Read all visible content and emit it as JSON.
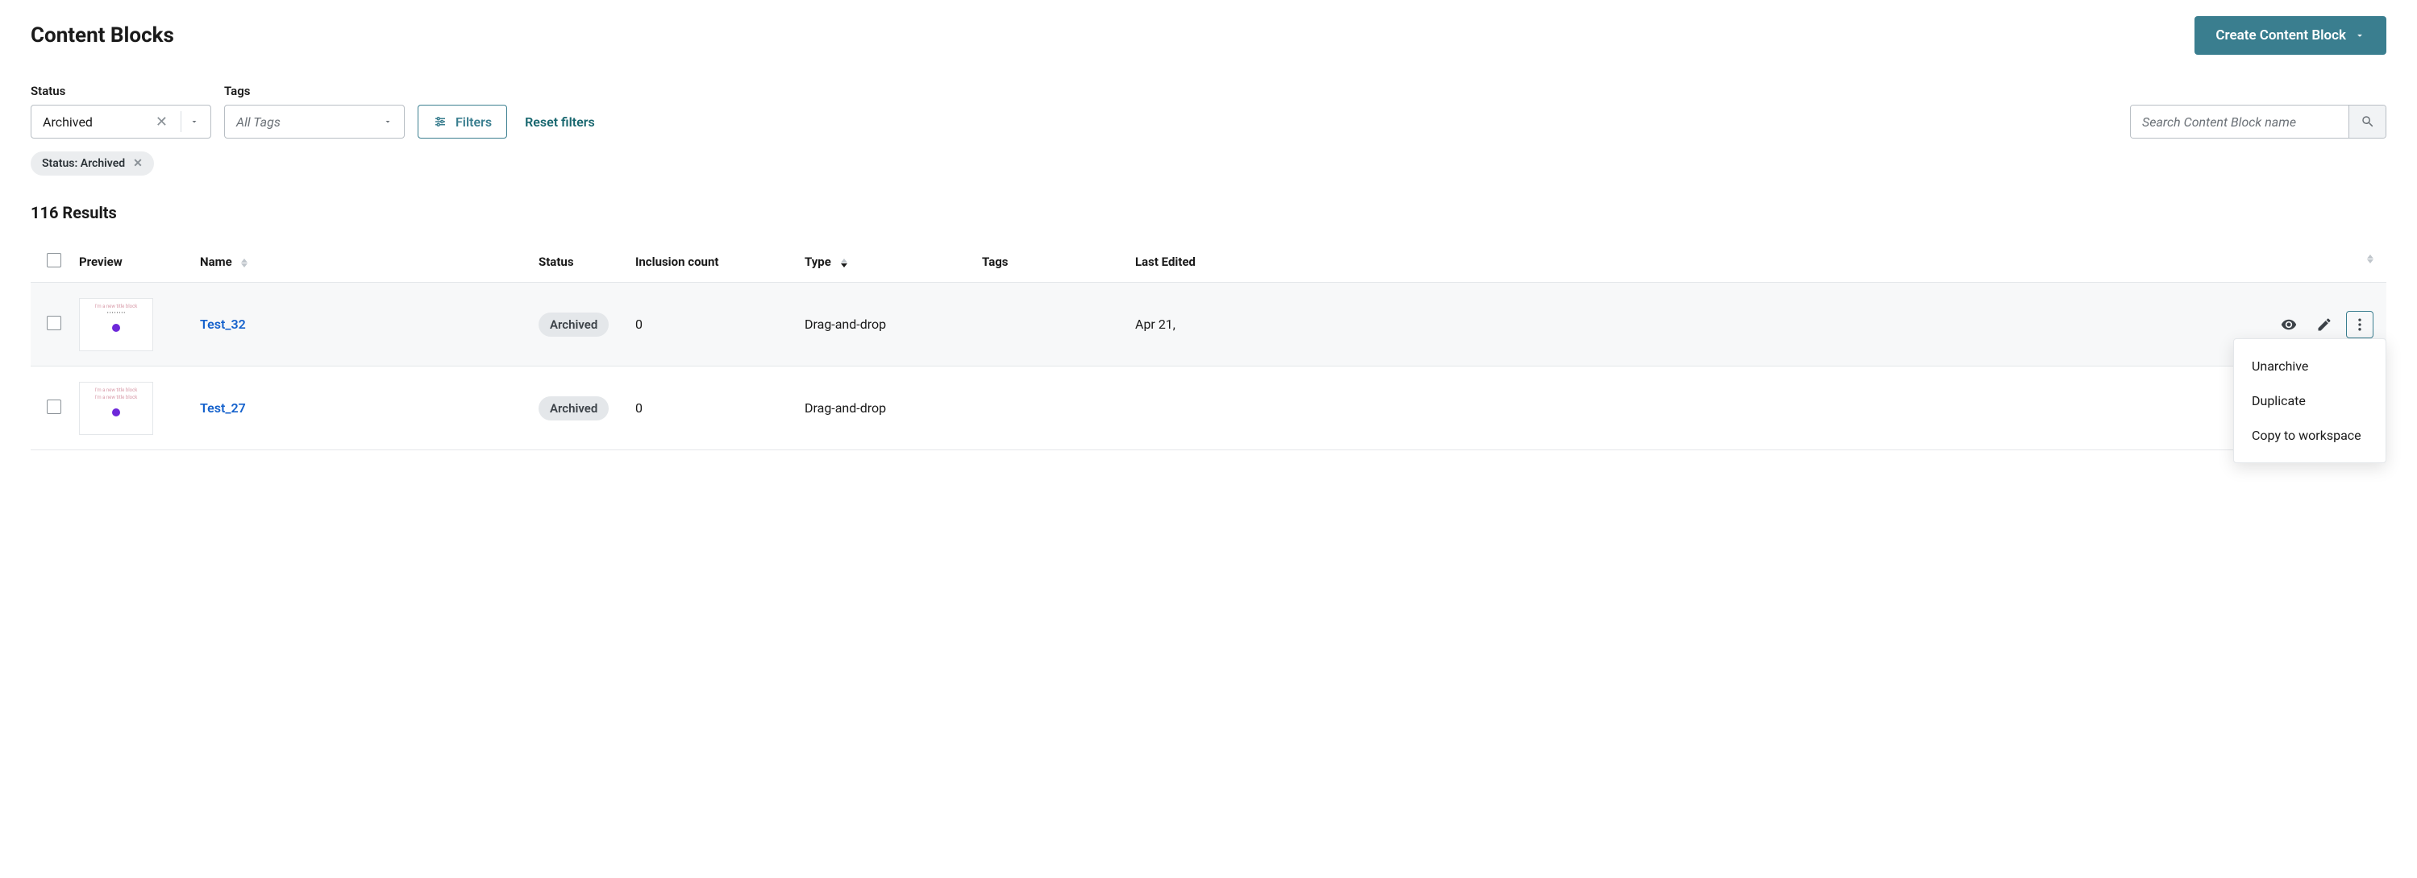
{
  "header": {
    "title": "Content Blocks",
    "create_label": "Create Content Block"
  },
  "filters": {
    "status_label": "Status",
    "status_value": "Archived",
    "tags_label": "Tags",
    "tags_value": "All Tags",
    "filters_btn": "Filters",
    "reset_label": "Reset filters"
  },
  "search": {
    "placeholder": "Search Content Block name"
  },
  "chip": {
    "label": "Status: Archived"
  },
  "results_label": "116 Results",
  "columns": {
    "preview": "Preview",
    "name": "Name",
    "status": "Status",
    "inclusion": "Inclusion count",
    "type": "Type",
    "tags": "Tags",
    "last_edited": "Last Edited"
  },
  "rows": [
    {
      "name": "Test_32",
      "status": "Archived",
      "inclusion": "0",
      "type": "Drag-and-drop",
      "date": "Apr 21,",
      "hovered": true
    },
    {
      "name": "Test_27",
      "status": "Archived",
      "inclusion": "0",
      "type": "Drag-and-drop",
      "date": "",
      "hovered": false
    }
  ],
  "menu": {
    "unarchive": "Unarchive",
    "duplicate": "Duplicate",
    "copy": "Copy to workspace"
  }
}
